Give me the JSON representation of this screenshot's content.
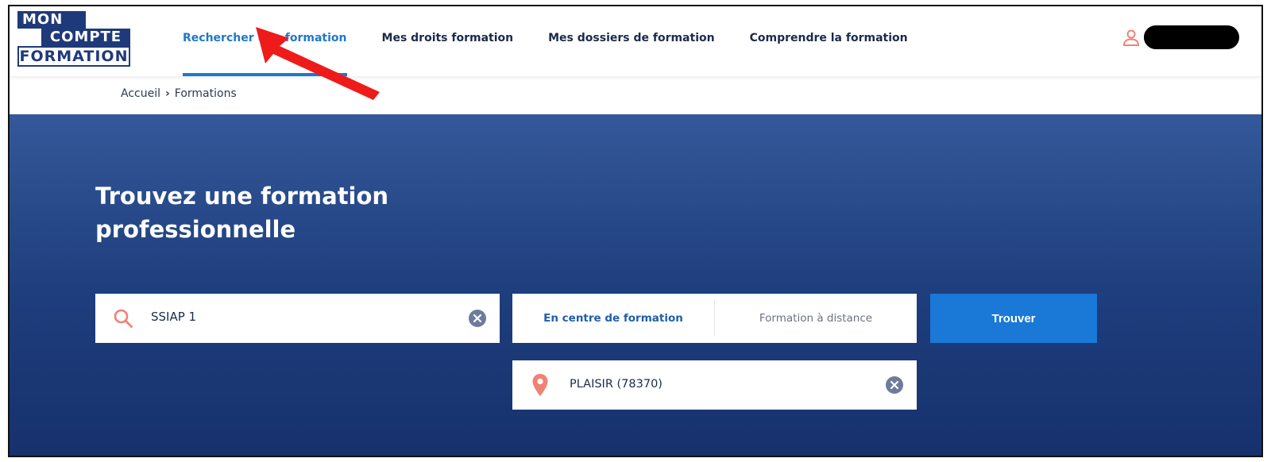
{
  "logo": {
    "line1": "MON",
    "line2": "COMPTE",
    "line3": "FORMATION"
  },
  "nav": [
    {
      "label": "Rechercher une formation",
      "active": true
    },
    {
      "label": "Mes droits formation",
      "active": false
    },
    {
      "label": "Mes dossiers de formation",
      "active": false
    },
    {
      "label": "Comprendre la formation",
      "active": false
    }
  ],
  "user": {
    "icon": "user-icon",
    "name": "████████"
  },
  "breadcrumb": {
    "home": "Accueil",
    "separator": "›",
    "current": "Formations"
  },
  "hero": {
    "title": "Trouvez une formation professionnelle"
  },
  "search": {
    "value": "SSIAP 1",
    "icon": "search-icon",
    "clear_icon": "clear-icon"
  },
  "mode": {
    "options": [
      "En centre de formation",
      "Formation à distance"
    ],
    "selected": "En centre de formation"
  },
  "find_button": {
    "label": "Trouver"
  },
  "location": {
    "value": "PLAISIR (78370)",
    "icon": "location-pin-icon"
  },
  "colors": {
    "brand": "#1f3a7a",
    "accent": "#1a78d6",
    "hero_top": "#34589a",
    "hero_bottom": "#16306c",
    "icon_salmon": "#f08275",
    "annotation_arrow": "#ee1b1b"
  }
}
